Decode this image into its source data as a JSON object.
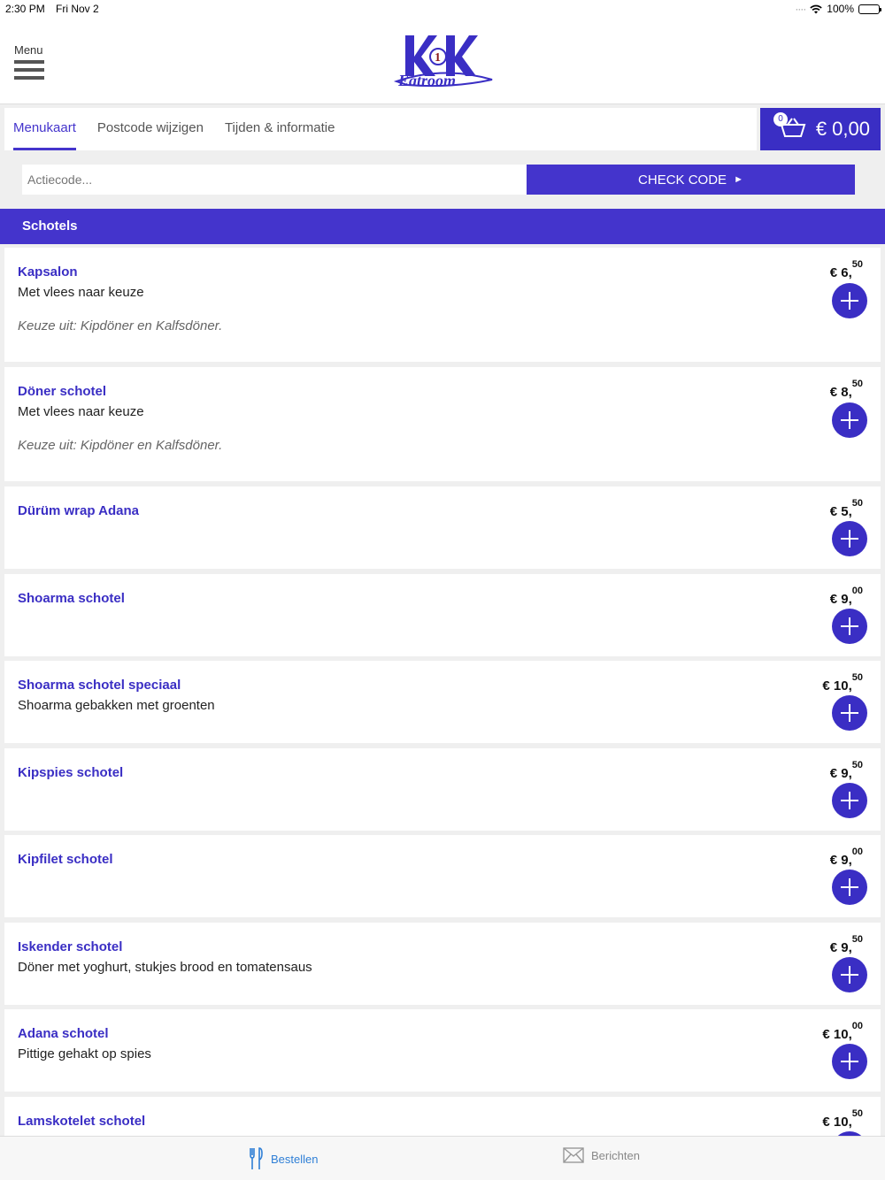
{
  "status_bar": {
    "time": "2:30 PM",
    "date": "Fri Nov 2",
    "battery": "100%"
  },
  "header": {
    "menu_label": "Menu",
    "logo_text": "Eatroom"
  },
  "tabs": [
    {
      "label": "Menukaart",
      "active": true
    },
    {
      "label": "Postcode wijzigen",
      "active": false
    },
    {
      "label": "Tijden & informatie",
      "active": false
    }
  ],
  "cart": {
    "count": "0",
    "total": "€ 0,00"
  },
  "action": {
    "placeholder": "Actiecode...",
    "button_label": "CHECK CODE"
  },
  "category": {
    "title": "Schotels"
  },
  "items": [
    {
      "name": "Kapsalon",
      "desc": "Met vlees naar keuze",
      "note": "Keuze uit: Kipdöner en Kalfsdöner.",
      "price_main": "€ 6,",
      "price_cents": "50"
    },
    {
      "name": "Döner schotel",
      "desc": "Met vlees naar keuze",
      "note": "Keuze uit: Kipdöner en Kalfsdöner.",
      "price_main": "€ 8,",
      "price_cents": "50"
    },
    {
      "name": "Dürüm wrap Adana",
      "desc": "",
      "note": "",
      "price_main": "€ 5,",
      "price_cents": "50"
    },
    {
      "name": "Shoarma schotel",
      "desc": "",
      "note": "",
      "price_main": "€ 9,",
      "price_cents": "00"
    },
    {
      "name": "Shoarma schotel speciaal",
      "desc": "Shoarma gebakken met groenten",
      "note": "",
      "price_main": "€ 10,",
      "price_cents": "50"
    },
    {
      "name": "Kipspies schotel",
      "desc": "",
      "note": "",
      "price_main": "€ 9,",
      "price_cents": "50"
    },
    {
      "name": "Kipfilet schotel",
      "desc": "",
      "note": "",
      "price_main": "€ 9,",
      "price_cents": "00"
    },
    {
      "name": "Iskender schotel",
      "desc": "Döner met yoghurt, stukjes brood en tomatensaus",
      "note": "",
      "price_main": "€ 9,",
      "price_cents": "50"
    },
    {
      "name": "Adana schotel",
      "desc": "Pittige gehakt op spies",
      "note": "",
      "price_main": "€ 10,",
      "price_cents": "00"
    },
    {
      "name": "Lamskotelet schotel",
      "desc": "",
      "note": "",
      "price_main": "€ 10,",
      "price_cents": "50"
    }
  ],
  "bottom_nav": [
    {
      "label": "Bestellen",
      "icon": "fork-knife-icon",
      "active": true
    },
    {
      "label": "Berichten",
      "icon": "envelope-icon",
      "active": false
    }
  ],
  "colors": {
    "accent": "#4434cc",
    "active_nav": "#2f7fd6"
  }
}
